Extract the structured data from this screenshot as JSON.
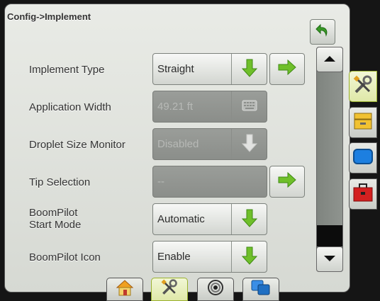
{
  "header": {
    "title": "Config->Implement"
  },
  "rows": [
    {
      "label": "Implement Type",
      "value": "Straight"
    },
    {
      "label": "Application Width",
      "value": "49.21 ft"
    },
    {
      "label": "Droplet Size Monitor",
      "value": "Disabled"
    },
    {
      "label": "Tip Selection",
      "value": "--"
    },
    {
      "label": "BoomPilot\nStart Mode",
      "value": "Automatic"
    },
    {
      "label": "BoomPilot Icon",
      "value": "Enable"
    }
  ],
  "colors": {
    "accent_green": "#6fbf2a",
    "back_arrow_green": "#3a9a28",
    "active_tab": "#dfe8a8"
  },
  "icons": {
    "back": "return-arrow-icon",
    "right_tabs": [
      "tools-icon",
      "console-icon",
      "display-icon",
      "toolbox-icon"
    ],
    "bottom_tabs": [
      "home-icon",
      "tools-icon",
      "gps-icon",
      "overlap-icon"
    ]
  }
}
